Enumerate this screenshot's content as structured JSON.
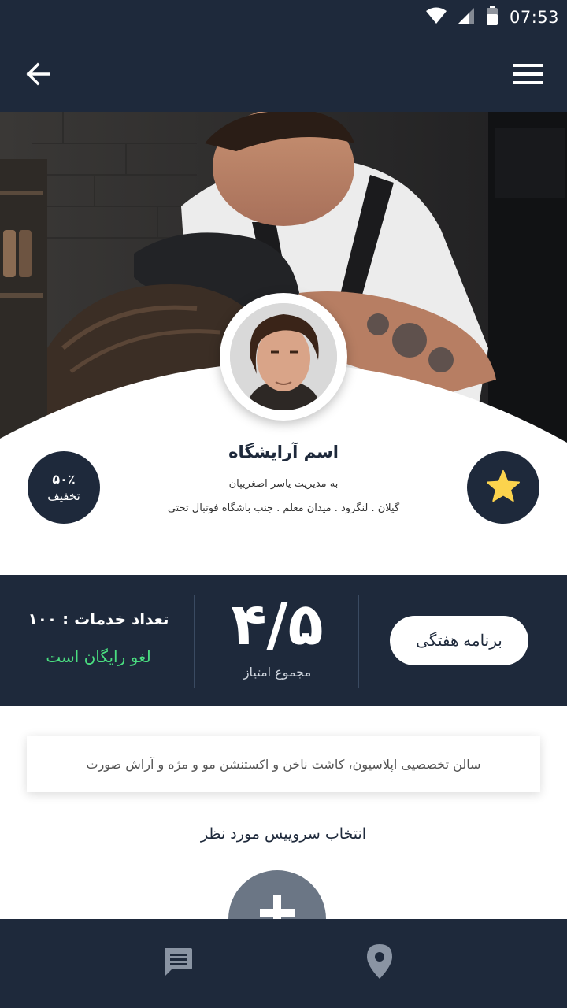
{
  "status_bar": {
    "time": "07:53"
  },
  "app_bar": {
    "back_icon": "arrow-left-icon",
    "menu_icon": "hamburger-menu-icon"
  },
  "profile": {
    "name": "اسم آرایشگاه",
    "manager": "به مدیریت یاسر اصغریپان",
    "address": "گیلان . لنگرود . میدان معلم . جنب باشگاه فوتبال تختی",
    "discount_percent": "۵۰٪",
    "discount_label": "تخفیف",
    "favorite_icon": "star-icon",
    "colors": {
      "star": "#fcd34d",
      "badge_bg": "#1e293b"
    }
  },
  "stats": {
    "services_count": "تعداد خدمات : ۱۰۰",
    "free_cancel": "لغو رایگان است",
    "rating": "۴/۵",
    "rating_label": "مجموع امتیاز",
    "weekly_button": "برنامه هفتگی",
    "colors": {
      "background": "#1e293b",
      "free_cancel": "#4ade80"
    }
  },
  "description": "سالن تخصصیی اپلاسیون، کاشت ناخن و اکستنشن مو و مژه و آراش صورت",
  "select_service_title": "انتخاب سروییس مورد نظر",
  "add_button_icon": "plus-icon",
  "bottom_nav": {
    "items": [
      {
        "icon": "chat-icon"
      },
      {
        "icon": "location-pin-icon"
      }
    ]
  }
}
